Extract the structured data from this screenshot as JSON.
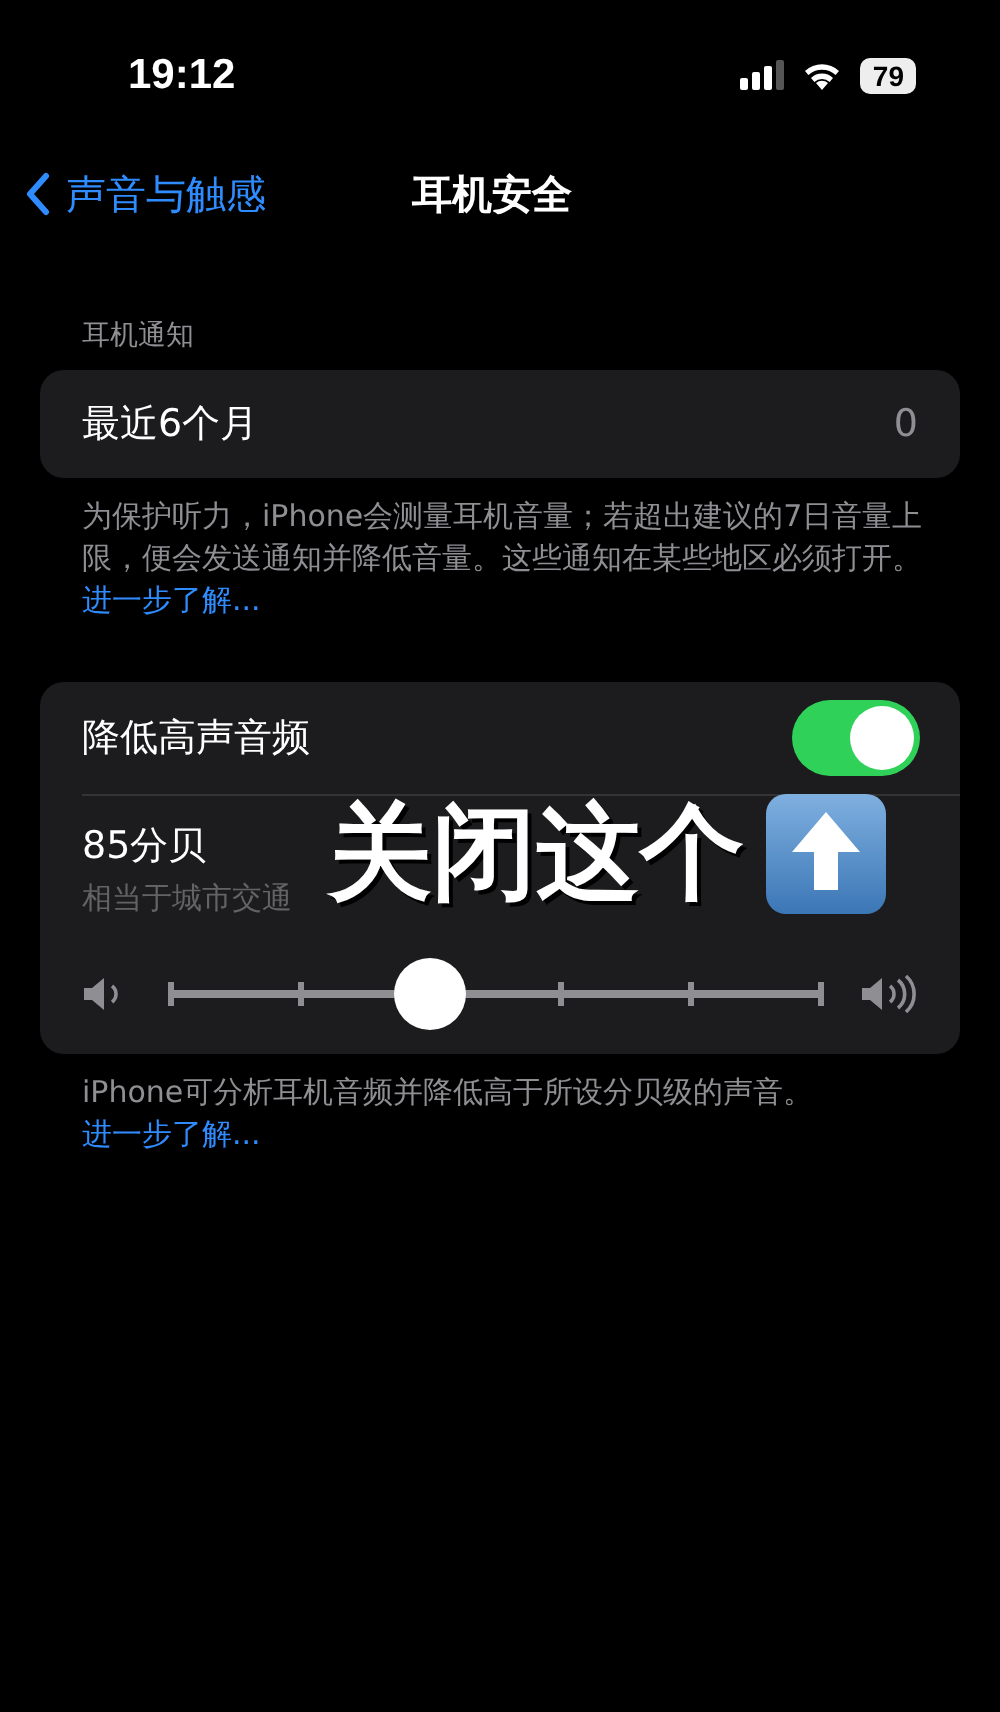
{
  "status_bar": {
    "time": "19:12",
    "battery": "79"
  },
  "nav": {
    "back": "声音与触感",
    "title": "耳机安全"
  },
  "notifications": {
    "header": "耳机通知",
    "row": {
      "label": "最近6个月",
      "value": "0"
    },
    "footer": "为保护听力，iPhone会测量耳机音量；若超出建议的7日音量上限，便会发送通知并降低音量。这些通知在某些地区必须打开。",
    "link": "进一步了解..."
  },
  "reduce_loud": {
    "label": "降低高声音频",
    "on": true,
    "level_title": "85分贝",
    "level_subtitle": "相当于城市交通",
    "slider": {
      "level": 0.4
    },
    "footer": "iPhone可分析耳机音频并降低高于所设分贝级的声音。",
    "link": "进一步了解..."
  },
  "annotation": {
    "text": "关闭这个"
  }
}
